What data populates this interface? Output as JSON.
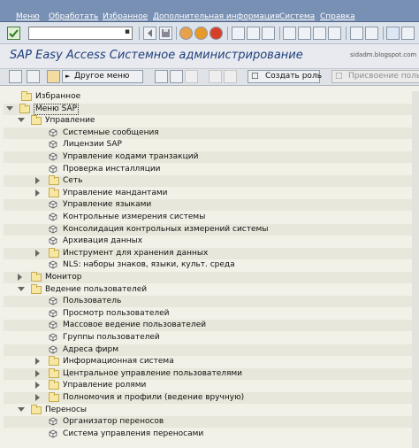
{
  "menubar": {
    "items": [
      "Меню",
      "Обработать",
      "Избранное",
      "Дополнительная информация",
      "Система",
      "Справка"
    ]
  },
  "command_field": {
    "value": ""
  },
  "title": "SAP Easy Access  Системное администрирование",
  "watermark": "sidadm.blogspot.com",
  "toolbar2": {
    "other_menu": "Другое меню",
    "create_role": "Создать роль",
    "assign_users": "Присвоение польз"
  },
  "tree": [
    {
      "label": "Избранное",
      "level": 0,
      "kind": "folder",
      "state": "none"
    },
    {
      "label": "Меню SAP",
      "level": 0,
      "kind": "folder",
      "state": "open",
      "selected": true
    },
    {
      "label": "Управление",
      "level": 1,
      "kind": "folder",
      "state": "open"
    },
    {
      "label": "Системные сообщения",
      "level": 2,
      "kind": "transaction"
    },
    {
      "label": "Лицензии SAP",
      "level": 2,
      "kind": "transaction"
    },
    {
      "label": "Управление кодами транзакций",
      "level": 2,
      "kind": "transaction"
    },
    {
      "label": "Проверка инсталляции",
      "level": 2,
      "kind": "transaction"
    },
    {
      "label": "Сеть",
      "level": 2,
      "kind": "folder",
      "state": "closed"
    },
    {
      "label": "Управление мандантами",
      "level": 2,
      "kind": "folder",
      "state": "closed"
    },
    {
      "label": "Управление языками",
      "level": 2,
      "kind": "transaction"
    },
    {
      "label": "Контрольные измерения системы",
      "level": 2,
      "kind": "transaction"
    },
    {
      "label": "Консолидация контрольных измерений системы",
      "level": 2,
      "kind": "transaction"
    },
    {
      "label": "Архивация данных",
      "level": 2,
      "kind": "transaction"
    },
    {
      "label": "Инструмент для хранения данных",
      "level": 2,
      "kind": "folder",
      "state": "closed"
    },
    {
      "label": "NLS: наборы знаков, языки, культ. среда",
      "level": 2,
      "kind": "transaction"
    },
    {
      "label": "Монитор",
      "level": 1,
      "kind": "folder",
      "state": "closed"
    },
    {
      "label": "Ведение пользователей",
      "level": 1,
      "kind": "folder",
      "state": "open"
    },
    {
      "label": "Пользователь",
      "level": 2,
      "kind": "transaction"
    },
    {
      "label": "Просмотр пользователей",
      "level": 2,
      "kind": "transaction"
    },
    {
      "label": "Массовое ведение пользователей",
      "level": 2,
      "kind": "transaction"
    },
    {
      "label": "Группы пользователей",
      "level": 2,
      "kind": "transaction"
    },
    {
      "label": "Адреса фирм",
      "level": 2,
      "kind": "transaction"
    },
    {
      "label": "Информационная система",
      "level": 2,
      "kind": "folder",
      "state": "closed"
    },
    {
      "label": "Центральное управление пользователями",
      "level": 2,
      "kind": "folder",
      "state": "closed"
    },
    {
      "label": "Управление ролями",
      "level": 2,
      "kind": "folder",
      "state": "closed"
    },
    {
      "label": "Полномочия и профили (ведение вручную)",
      "level": 2,
      "kind": "folder",
      "state": "closed"
    },
    {
      "label": "Переносы",
      "level": 1,
      "kind": "folder",
      "state": "open"
    },
    {
      "label": "Организатор переносов",
      "level": 2,
      "kind": "transaction"
    },
    {
      "label": "Система управления переносами",
      "level": 2,
      "kind": "transaction"
    }
  ]
}
